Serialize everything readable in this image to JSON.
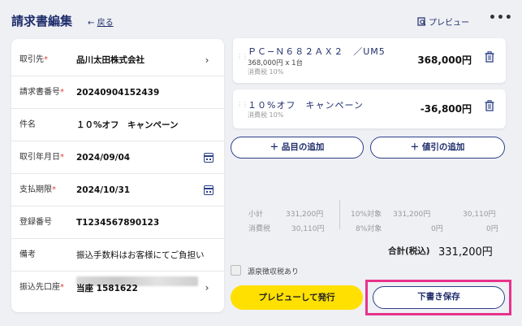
{
  "header": {
    "title": "請求書編集",
    "back_label": "戻る",
    "back_arrow": "←",
    "preview_label": "プレビュー",
    "more": "•••"
  },
  "form": {
    "fields": [
      {
        "label": "取引先",
        "required": "*",
        "value": "品川太田株式会社"
      },
      {
        "label": "請求書番号",
        "required": "*",
        "value": "20240904152439"
      },
      {
        "label": "件名",
        "required": "",
        "value": "１０%オフ　キャンペーン"
      },
      {
        "label": "取引年月日",
        "required": "*",
        "value": "2024/09/04"
      },
      {
        "label": "支払期限",
        "required": "*",
        "value": "2024/10/31"
      },
      {
        "label": "登録番号",
        "required": "",
        "value": "T1234567890123"
      },
      {
        "label": "備考",
        "required": "",
        "value": "振込手数料はお客様にてご負担い"
      },
      {
        "label": "振込先口座",
        "required": "*",
        "value": "当座 1581622"
      }
    ]
  },
  "items": [
    {
      "name": "ＰＣ−Ｎ６８２ＡＸ２　／UM5",
      "detail": "368,000円 x 1台",
      "tax": "消費税 10%",
      "amount": "368,000円"
    },
    {
      "name": "１０%オフ　キャンペーン",
      "detail": "",
      "tax": "消費税 10%",
      "amount": "-36,800円"
    }
  ],
  "actions": {
    "add_item": "＋ 品目の追加",
    "add_discount": "＋ 値引の追加"
  },
  "totals": {
    "subtotal_label": "小計",
    "subtotal": "331,200円",
    "tax_label": "消費税",
    "tax": "30,110円",
    "rate10_label": "10%対象",
    "rate10_base": "331,200円",
    "rate10_tax": "30,110円",
    "rate8_label": "8%対象",
    "rate8_base": "0円",
    "rate8_tax": "0円",
    "grand_label": "合計(税込)",
    "grand_value": "331,200円"
  },
  "withholding_label": "源泉徴収税あり",
  "buttons": {
    "preview_issue": "プレビューして発行",
    "save_draft": "下書き保存"
  },
  "colors": {
    "accent": "#1f2d6b",
    "required": "#e0403a",
    "issue_button": "#ffe000",
    "highlight": "#e8328a"
  }
}
